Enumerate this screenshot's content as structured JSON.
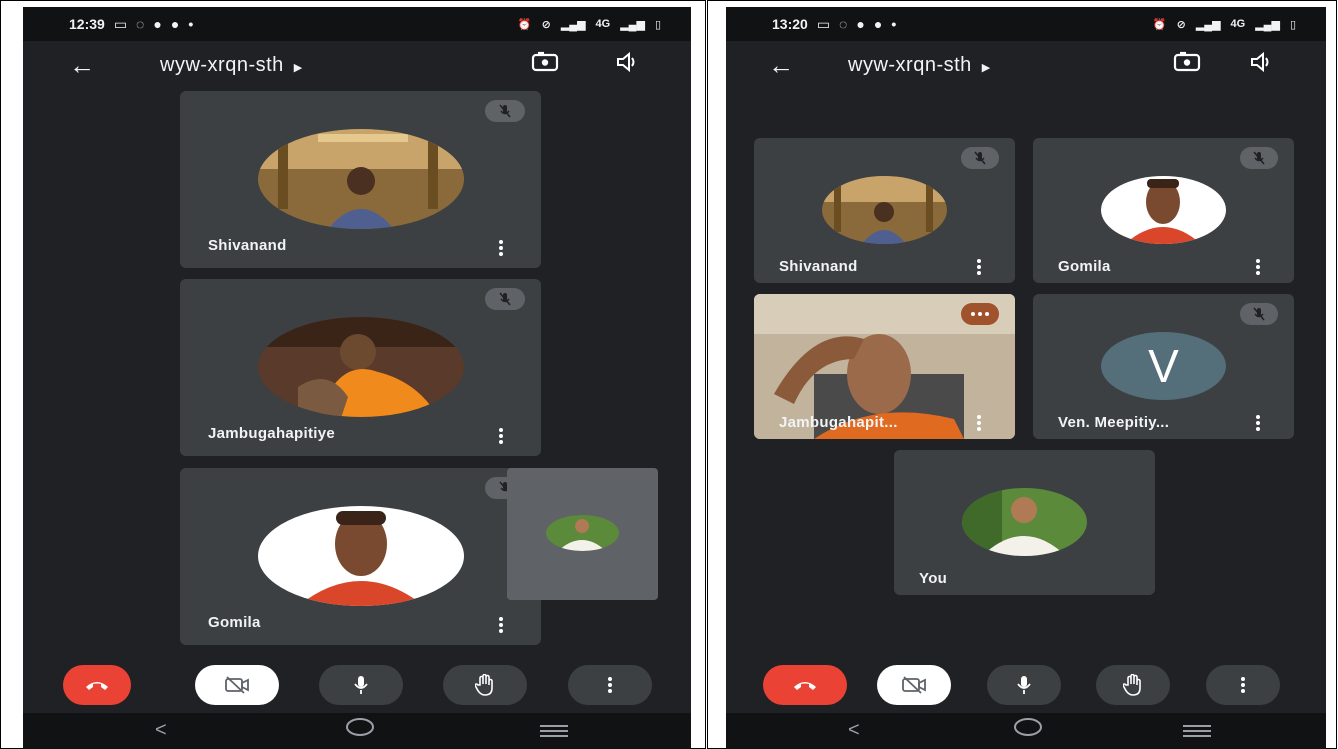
{
  "left": {
    "status": {
      "time": "12:39",
      "net": "4G"
    },
    "meeting": {
      "code": "wyw-xrqn-sth"
    },
    "tiles": [
      {
        "name": "Shivanand"
      },
      {
        "name": "Jambugahapitiye"
      },
      {
        "name": "Gomila"
      }
    ]
  },
  "right": {
    "status": {
      "time": "13:20",
      "net": "4G"
    },
    "meeting": {
      "code": "wyw-xrqn-sth"
    },
    "tiles": [
      {
        "name": "Shivanand"
      },
      {
        "name": "Gomila"
      },
      {
        "name": "Jambugahapit..."
      },
      {
        "name": "Ven. Meepitiy...",
        "initial": "V"
      },
      {
        "name": "You"
      }
    ]
  },
  "colors": {
    "background": "#202124",
    "tile": "#3c4043",
    "hangup": "#ea4335",
    "avatar_letter_bg": "#546e7a"
  },
  "icons": [
    "back-arrow-icon",
    "camera-flip-icon",
    "speaker-icon",
    "mic-off-icon",
    "more-vert-icon",
    "hangup-icon",
    "camera-off-icon",
    "mic-icon",
    "raise-hand-icon",
    "nav-back-icon",
    "nav-home-icon",
    "nav-recents-icon"
  ]
}
